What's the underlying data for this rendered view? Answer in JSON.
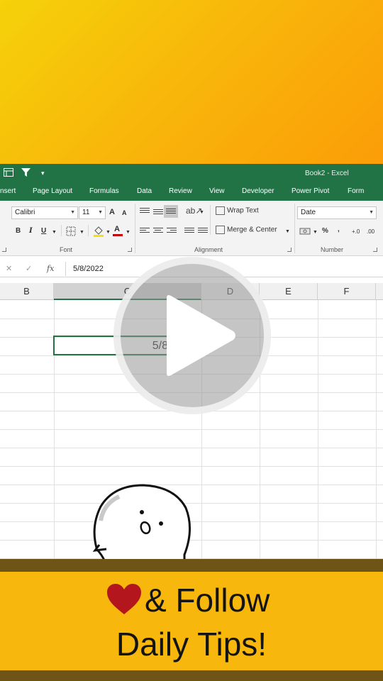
{
  "window": {
    "title": "Book2 - Excel"
  },
  "tabs": [
    "nsert",
    "Page Layout",
    "Formulas",
    "Data",
    "Review",
    "View",
    "Developer",
    "Power Pivot",
    "Form"
  ],
  "ribbon": {
    "font_name": "Calibri",
    "font_size": "11",
    "grow_font": "A",
    "shrink_font": "A",
    "bold": "B",
    "italic": "I",
    "underline": "U",
    "font_color_glyph": "A",
    "wrap_text": "Wrap Text",
    "merge_center": "Merge & Center",
    "number_format": "Date",
    "percent": "%",
    "comma": ",",
    "inc_decimal": "+.0",
    "dec_decimal": ".00",
    "group_font": "Font",
    "group_alignment": "Alignment",
    "group_number": "Number"
  },
  "formula_bar": {
    "cancel": "✕",
    "enter": "✓",
    "fx": "fx",
    "value": "5/8/2022"
  },
  "columns": [
    "B",
    "C",
    "D",
    "E",
    "F"
  ],
  "active_cell": {
    "column": "C",
    "value": "5/8/2022"
  },
  "banner": {
    "line1": "& Follow",
    "line2": "Daily Tips!"
  },
  "colors": {
    "excel_green": "#217346",
    "banner": "#f8b70c",
    "band": "#6f5418",
    "heart": "#b3171d"
  }
}
